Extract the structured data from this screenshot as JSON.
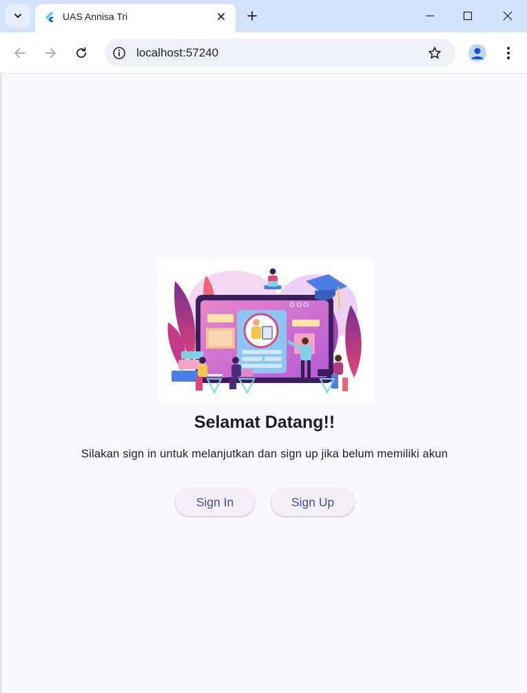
{
  "browser": {
    "tab": {
      "title": "UAS Annisa Tri",
      "favicon": "flutter-icon"
    },
    "address_bar": {
      "url": "localhost:57240"
    },
    "colors": {
      "tabstrip": "#d3e3fd",
      "omnibox": "#eef1f7"
    }
  },
  "page": {
    "title": "Selamat Datang!!",
    "subtitle": "Silakan sign in untuk melanjutkan dan sign up jika belum memiliki akun",
    "buttons": {
      "sign_in": "Sign In",
      "sign_up": "Sign Up"
    },
    "illustration": "online-class-illustration",
    "colors": {
      "background": "#faf8fd",
      "button_bg": "#f4eff7",
      "button_text": "#3f528f",
      "title": "#1d1b20"
    }
  }
}
